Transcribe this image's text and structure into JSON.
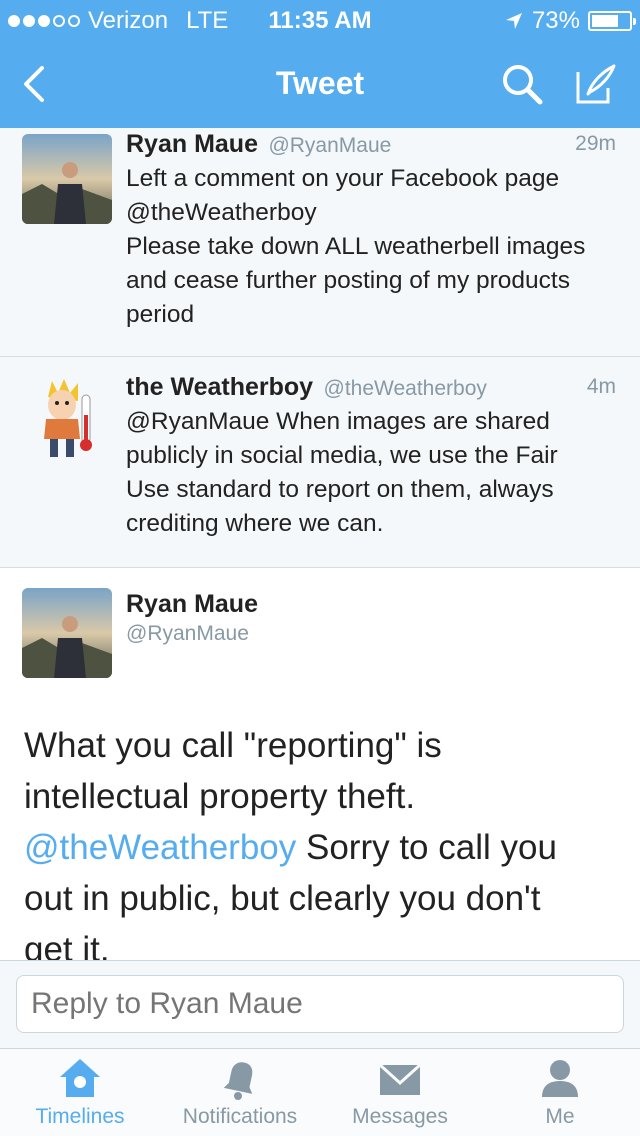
{
  "status": {
    "carrier": "Verizon",
    "network": "LTE",
    "time": "11:35 AM",
    "battery": "73%",
    "battery_level": 0.73
  },
  "nav": {
    "title": "Tweet"
  },
  "tweets": [
    {
      "name": "Ryan Maue",
      "handle": "@RyanMaue",
      "time": "29m",
      "text_lines": [
        "Left a comment on your Facebook page",
        "@theWeatherboy",
        "Please take down ALL weatherbell images",
        "and cease further posting of my products",
        "period"
      ]
    },
    {
      "name": "the Weatherboy",
      "handle": "@theWeatherboy",
      "time": "4m",
      "text_lines": [
        "@RyanMaue When images are shared",
        "publicly in social media, we use the Fair",
        "Use standard to report on them, always",
        "crediting where we can."
      ]
    }
  ],
  "detail": {
    "name": "Ryan Maue",
    "handle": "@RyanMaue",
    "line1": "What you call \"reporting\" is",
    "line2": "intellectual property theft.",
    "mention": "@theWeatherboy",
    "line3_rest": " Sorry to call you",
    "line4": "out in public, but clearly you don't",
    "line5": "get it."
  },
  "reply": {
    "placeholder": "Reply to Ryan Maue"
  },
  "tabs": [
    {
      "label": "Timelines",
      "icon": "home-icon",
      "active": true
    },
    {
      "label": "Notifications",
      "icon": "bell-icon",
      "active": false
    },
    {
      "label": "Messages",
      "icon": "envelope-icon",
      "active": false
    },
    {
      "label": "Me",
      "icon": "person-icon",
      "active": false
    }
  ],
  "colors": {
    "brand": "#55acee",
    "muted": "#8899a6"
  }
}
